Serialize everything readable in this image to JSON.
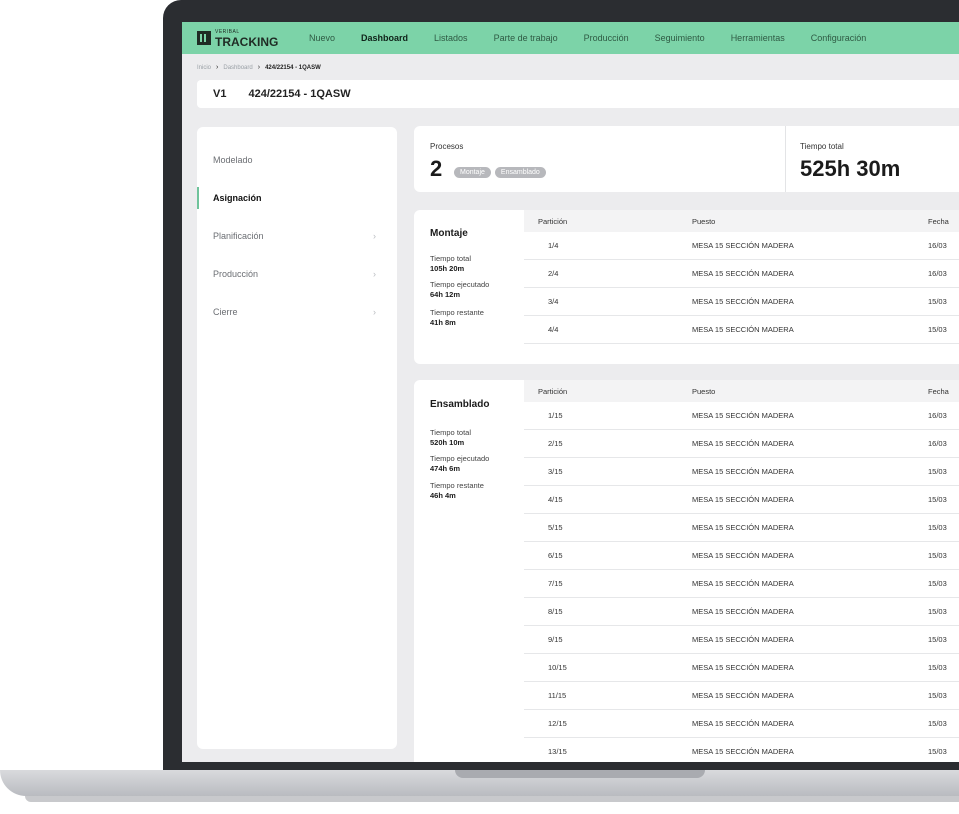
{
  "app": {
    "logo_small": "VERIBAL",
    "logo_name": "TRACKING",
    "nav": [
      "Nuevo",
      "Dashboard",
      "Listados",
      "Parte de trabajo",
      "Producción",
      "Seguimiento",
      "Herramientas",
      "Configuración"
    ],
    "nav_active": "Dashboard"
  },
  "breadcrumb": {
    "items": [
      "Inicio",
      "Dashboard"
    ],
    "current": "424/22154 - 1QASW"
  },
  "titlebar": {
    "version": "V1",
    "name": "424/22154 - 1QASW"
  },
  "sidebar": {
    "items": [
      {
        "label": "Modelado",
        "chevron": ""
      },
      {
        "label": "Asignación",
        "chevron": ""
      },
      {
        "label": "Planificación",
        "chevron": "›"
      },
      {
        "label": "Producción",
        "chevron": "›"
      },
      {
        "label": "Cierre",
        "chevron": "›"
      }
    ],
    "active_index": 1
  },
  "summary": {
    "procesos_label": "Procesos",
    "procesos_count": "2",
    "tags": [
      "Montaje",
      "Ensamblado"
    ],
    "tiempo_label": "Tiempo total",
    "tiempo_value": "525h 30m"
  },
  "table_headers": {
    "particion": "Partición",
    "puesto": "Puesto",
    "fecha": "Fecha"
  },
  "montaje": {
    "title": "Montaje",
    "stats": [
      {
        "label": "Tiempo total",
        "value": "105h 20m"
      },
      {
        "label": "Tiempo ejecutado",
        "value": "64h 12m"
      },
      {
        "label": "Tiempo restante",
        "value": "41h 8m"
      }
    ],
    "rows": [
      {
        "particion": "1/4",
        "puesto": "MESA 15 SECCIÓN MADERA",
        "fecha": "16/03"
      },
      {
        "particion": "2/4",
        "puesto": "MESA 15 SECCIÓN MADERA",
        "fecha": "16/03"
      },
      {
        "particion": "3/4",
        "puesto": "MESA 15 SECCIÓN MADERA",
        "fecha": "15/03"
      },
      {
        "particion": "4/4",
        "puesto": "MESA 15 SECCIÓN MADERA",
        "fecha": "15/03"
      }
    ]
  },
  "ensamblado": {
    "title": "Ensamblado",
    "stats": [
      {
        "label": "Tiempo total",
        "value": "520h 10m"
      },
      {
        "label": "Tiempo ejecutado",
        "value": "474h 6m"
      },
      {
        "label": "Tiempo restante",
        "value": "46h 4m"
      }
    ],
    "rows": [
      {
        "particion": "1/15",
        "puesto": "MESA 15 SECCIÓN MADERA",
        "fecha": "16/03"
      },
      {
        "particion": "2/15",
        "puesto": "MESA 15 SECCIÓN MADERA",
        "fecha": "16/03"
      },
      {
        "particion": "3/15",
        "puesto": "MESA 15 SECCIÓN MADERA",
        "fecha": "15/03"
      },
      {
        "particion": "4/15",
        "puesto": "MESA 15 SECCIÓN MADERA",
        "fecha": "15/03"
      },
      {
        "particion": "5/15",
        "puesto": "MESA 15 SECCIÓN MADERA",
        "fecha": "15/03"
      },
      {
        "particion": "6/15",
        "puesto": "MESA 15 SECCIÓN MADERA",
        "fecha": "15/03"
      },
      {
        "particion": "7/15",
        "puesto": "MESA 15 SECCIÓN MADERA",
        "fecha": "15/03"
      },
      {
        "particion": "8/15",
        "puesto": "MESA 15 SECCIÓN MADERA",
        "fecha": "15/03"
      },
      {
        "particion": "9/15",
        "puesto": "MESA 15 SECCIÓN MADERA",
        "fecha": "15/03"
      },
      {
        "particion": "10/15",
        "puesto": "MESA 15 SECCIÓN MADERA",
        "fecha": "15/03"
      },
      {
        "particion": "11/15",
        "puesto": "MESA 15 SECCIÓN MADERA",
        "fecha": "15/03"
      },
      {
        "particion": "12/15",
        "puesto": "MESA 15 SECCIÓN MADERA",
        "fecha": "15/03"
      },
      {
        "particion": "13/15",
        "puesto": "MESA 15 SECCIÓN MADERA",
        "fecha": "15/03"
      }
    ]
  },
  "colors": {
    "nav_bg": "#7cd3a8",
    "accent": "#6fc39b",
    "bezel": "#2b2d31",
    "tag_bg": "#b7b8bc"
  }
}
